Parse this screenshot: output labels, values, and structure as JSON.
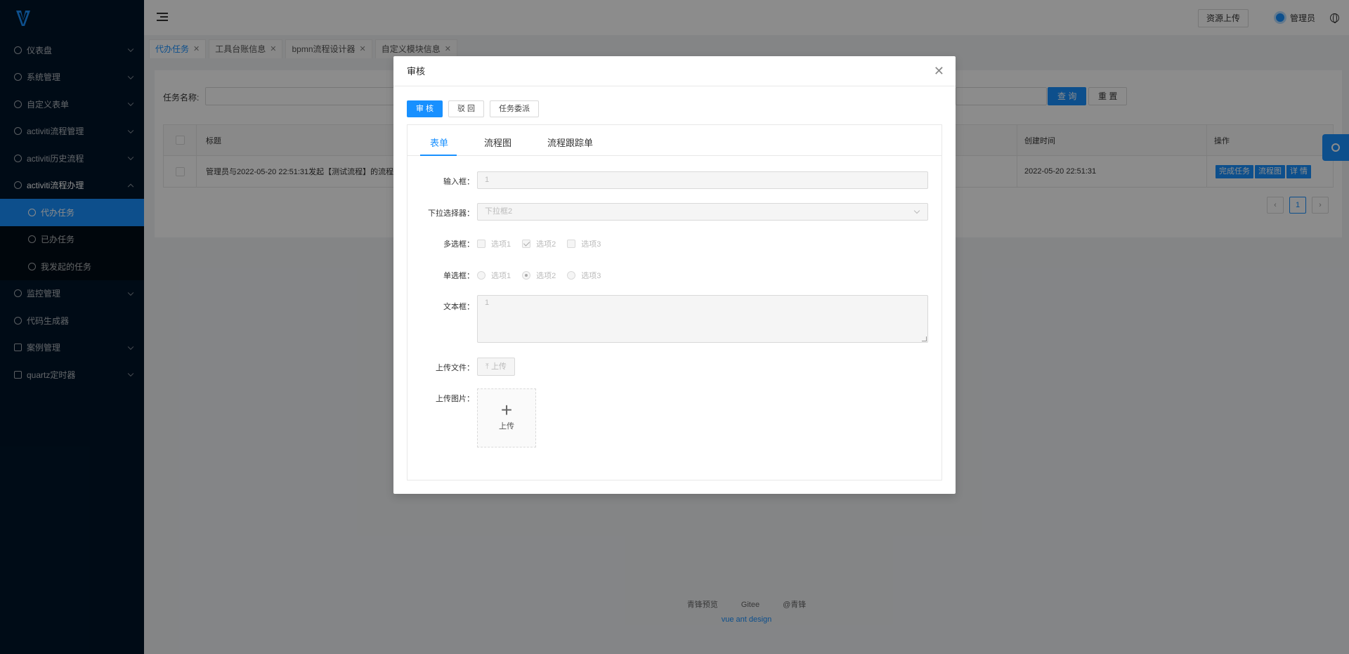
{
  "sidebar": {
    "items": [
      {
        "label": "仪表盘"
      },
      {
        "label": "系统管理"
      },
      {
        "label": "自定义表单"
      },
      {
        "label": "activiti流程管理"
      },
      {
        "label": "activiti历史流程"
      },
      {
        "label": "activiti流程办理"
      },
      {
        "label": "监控管理"
      },
      {
        "label": "代码生成器"
      },
      {
        "label": "案例管理"
      },
      {
        "label": "quartz定时器"
      }
    ],
    "subitems": [
      {
        "label": "代办任务"
      },
      {
        "label": "已办任务"
      },
      {
        "label": "我发起的任务"
      }
    ]
  },
  "header": {
    "upload_label": "资源上传",
    "user_name": "管理员"
  },
  "tabs": [
    {
      "label": "代办任务"
    },
    {
      "label": "工具台账信息"
    },
    {
      "label": "bpmn流程设计器"
    },
    {
      "label": "自定义模块信息"
    }
  ],
  "search": {
    "task_name_label": "任务名称:",
    "query_label": "查 询",
    "reset_label": "重 置"
  },
  "table": {
    "headers": {
      "title": "标题",
      "created": "创建时间",
      "actions": "操作"
    },
    "rows": [
      {
        "title": "管理员与2022-05-20 22:51:31发起【测试流程】的流程",
        "created": "2022-05-20 22:51:31"
      }
    ],
    "actions": {
      "complete": "完成任务",
      "flow": "流程图",
      "detail": "详 情"
    }
  },
  "pagination": {
    "current": "1"
  },
  "footer": {
    "links": [
      "青锋预览",
      "Gitee",
      "@青锋"
    ],
    "sub": "vue ant design"
  },
  "modal": {
    "title": "审核",
    "buttons": {
      "approve": "审 核",
      "reject": "驳 回",
      "delegate": "任务委派"
    },
    "tabs": [
      "表单",
      "流程图",
      "流程跟踪单"
    ],
    "form": {
      "input_label": "输入框：",
      "input_value": "1",
      "select_label": "下拉选择器：",
      "select_value": "下拉框2",
      "checkbox_label": "多选框：",
      "checkbox_options": [
        "选项1",
        "选项2",
        "选项3"
      ],
      "radio_label": "单选框：",
      "radio_options": [
        "选项1",
        "选项2",
        "选项3"
      ],
      "textarea_label": "文本框：",
      "textarea_value": "1",
      "file_label": "上传文件：",
      "file_button": "上传",
      "image_label": "上传图片：",
      "image_button": "上传"
    }
  }
}
